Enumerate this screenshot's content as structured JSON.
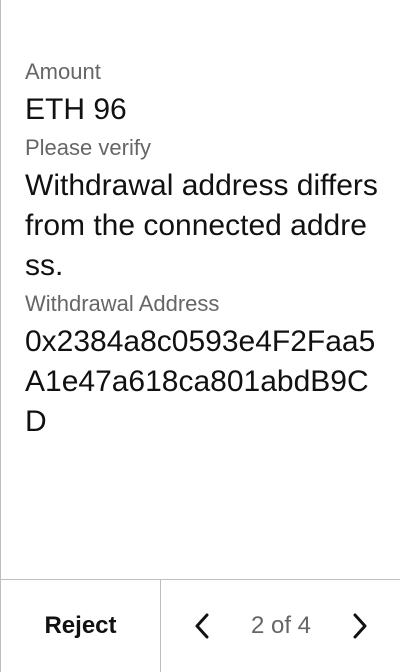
{
  "amount": {
    "label": "Amount",
    "value": "ETH 96"
  },
  "verify": {
    "label": "Please verify",
    "message": "Withdrawal address differs from the connected address."
  },
  "withdrawal": {
    "label": "Withdrawal Address",
    "address": "0x2384a8c0593e4F2Faa5A1e47a618ca801abdB9CD"
  },
  "footer": {
    "reject_label": "Reject",
    "pagination": {
      "current": 2,
      "total": 4,
      "text": "2 of 4"
    }
  },
  "icons": {
    "prev": "chevron-left-icon",
    "next": "chevron-right-icon"
  }
}
